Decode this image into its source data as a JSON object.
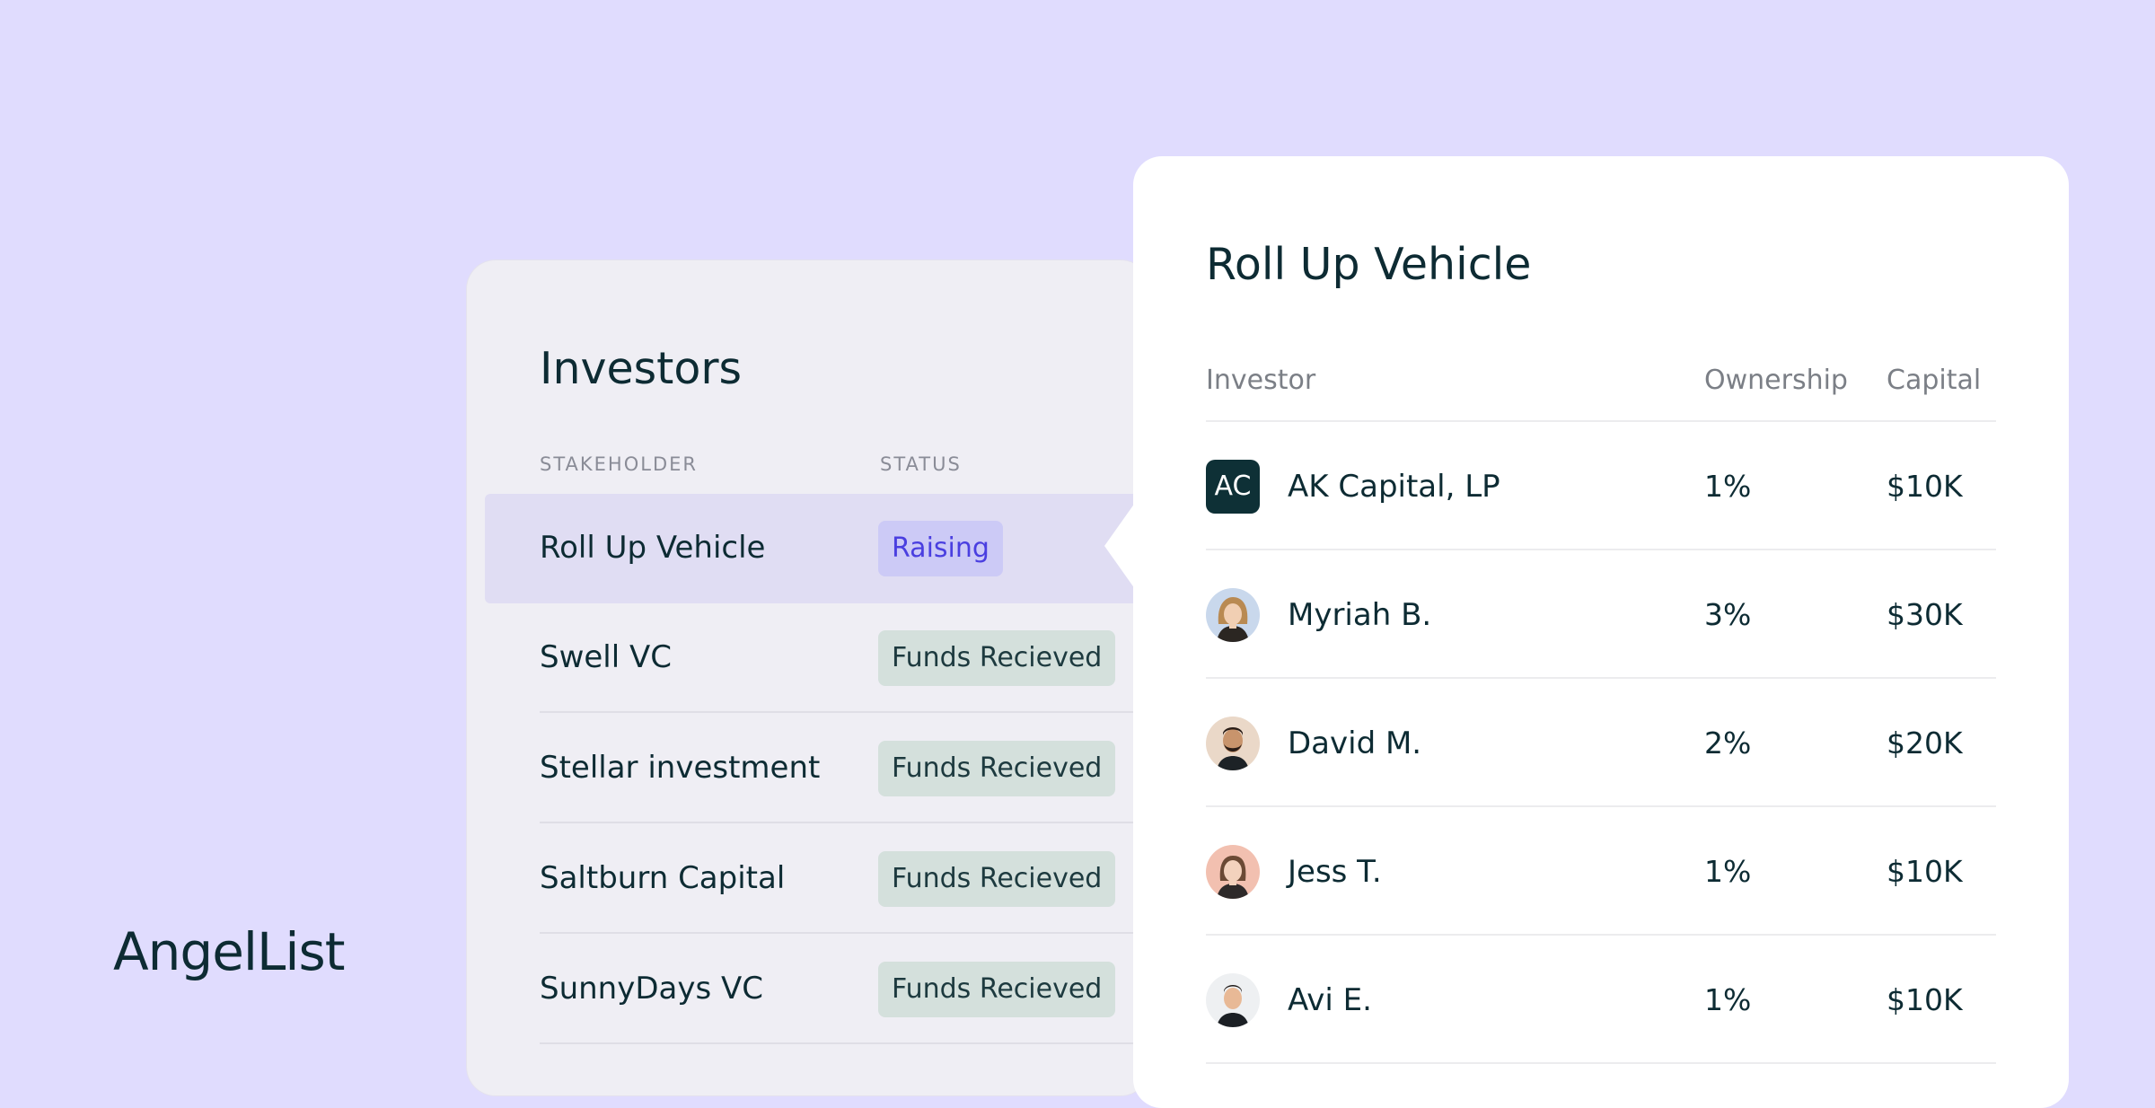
{
  "brand": {
    "name": "AngelList"
  },
  "investors_panel": {
    "title": "Investors",
    "columns": {
      "stakeholder": "STAKEHOLDER",
      "status": "STATUS"
    },
    "rows": [
      {
        "name": "Roll Up Vehicle",
        "status": "Raising",
        "selected": true
      },
      {
        "name": "Swell VC",
        "status": "Funds Recieved"
      },
      {
        "name": "Stellar investment",
        "status": "Funds Recieved"
      },
      {
        "name": "Saltburn Capital",
        "status": "Funds Recieved"
      },
      {
        "name": "SunnyDays VC",
        "status": "Funds Recieved"
      }
    ]
  },
  "detail_panel": {
    "title": "Roll Up Vehicle",
    "columns": {
      "investor": "Investor",
      "ownership": "Ownership",
      "capital": "Capital"
    },
    "rows": [
      {
        "avatar": "AC",
        "avatar_icon": "company-logo-icon",
        "name": "AK Capital, LP",
        "ownership": "1%",
        "capital": "$10K"
      },
      {
        "avatar_icon": "avatar-woman-icon",
        "name": "Myriah B.",
        "ownership": "3%",
        "capital": "$30K"
      },
      {
        "avatar_icon": "avatar-man-icon",
        "name": "David M.",
        "ownership": "2%",
        "capital": "$20K"
      },
      {
        "avatar_icon": "avatar-woman-icon",
        "name": "Jess T.",
        "ownership": "1%",
        "capital": "$10K"
      },
      {
        "avatar_icon": "avatar-man-icon",
        "name": "Avi E.",
        "ownership": "1%",
        "capital": "$10K"
      }
    ]
  },
  "colors": {
    "background": "#e0dcfe",
    "raising_badge_bg": "#cccaf6",
    "raising_badge_text": "#4a3fe0",
    "funds_badge_bg": "#d4e0dc",
    "logo_bg": "#0e3036",
    "text": "#0d2b33"
  }
}
